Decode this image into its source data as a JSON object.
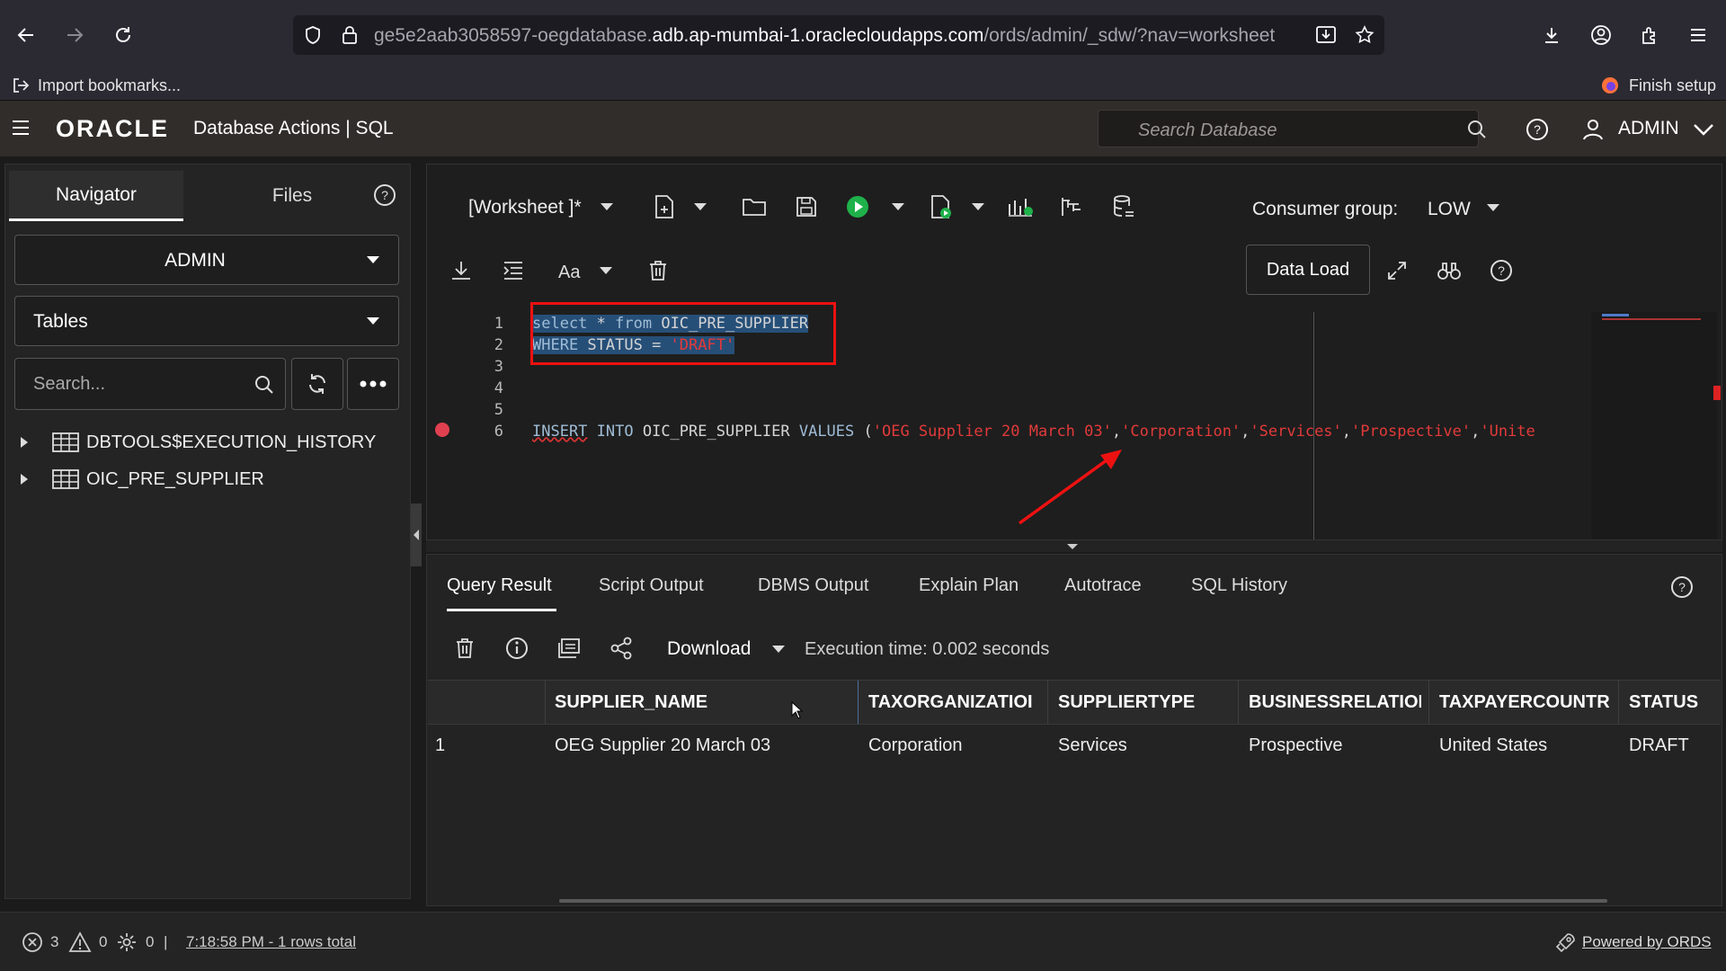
{
  "browser": {
    "url_prefix": "ge5e2aab3058597-oegdatabase.",
    "url_host": "adb.ap-mumbai-1.oraclecloudapps.com",
    "url_path": "/ords/admin/_sdw/?nav=worksheet",
    "bookmarks_import": "Import bookmarks...",
    "finish_setup": "Finish setup"
  },
  "app": {
    "logo": "ORACLE",
    "title": "Database Actions | SQL",
    "search_placeholder": "Search Database",
    "user": "ADMIN"
  },
  "navigator": {
    "tabs": [
      "Navigator",
      "Files"
    ],
    "schema": "ADMIN",
    "object_type": "Tables",
    "search_placeholder": "Search...",
    "items": [
      "DBTOOLS$EXECUTION_HISTORY",
      "OIC_PRE_SUPPLIER"
    ]
  },
  "worksheet": {
    "name": "[Worksheet ]*",
    "consumer_group_label": "Consumer group:",
    "consumer_group_value": "LOW",
    "data_load": "Data Load",
    "line_numbers": [
      "1",
      "2",
      "3",
      "4",
      "5",
      "6"
    ],
    "code": {
      "l1_kw1": "select",
      "l1_star": " * ",
      "l1_kw2": "from",
      "l1_table": " OIC_PRE_SUPPLIER",
      "l2_kw": "WHERE",
      "l2_rest": " STATUS = ",
      "l2_str": "'DRAFT'",
      "l6_kw1": "INSERT",
      "l6_kw2": " INTO",
      "l6_table": " OIC_PRE_SUPPLIER ",
      "l6_kw3": "VALUES",
      "l6_paren": " (",
      "l6_s1": "'OEG Supplier 20 March 03'",
      "l6_c1": ",",
      "l6_s2": "'Corporation'",
      "l6_c2": ",",
      "l6_s3": "'Services'",
      "l6_c3": ",",
      "l6_s4": "'Prospective'",
      "l6_c4": ",",
      "l6_s5": "'Unite"
    }
  },
  "results": {
    "tabs": [
      "Query Result",
      "Script Output",
      "DBMS Output",
      "Explain Plan",
      "Autotrace",
      "SQL History"
    ],
    "download": "Download",
    "execution_time": "Execution time: 0.002 seconds",
    "columns": [
      "SUPPLIER_NAME",
      "TAXORGANIZATIOI",
      "SUPPLIERTYPE",
      "BUSINESSRELATIOI",
      "TAXPAYERCOUNTR",
      "STATUS"
    ],
    "rows": [
      {
        "num": "1",
        "cells": [
          "OEG Supplier 20 March 03",
          "Corporation",
          "Services",
          "Prospective",
          "United States",
          "DRAFT"
        ]
      }
    ]
  },
  "status": {
    "errors": "3",
    "warnings": "0",
    "tasks": "0",
    "separator": "|",
    "summary": "7:18:58 PM - 1 rows total",
    "powered_by": "Powered by ORDS"
  },
  "colors": {
    "header_bg": "#312d2a",
    "string_red": "#e23a3a",
    "run_green": "#1fb14a",
    "highlight_box": "#ee1111"
  }
}
